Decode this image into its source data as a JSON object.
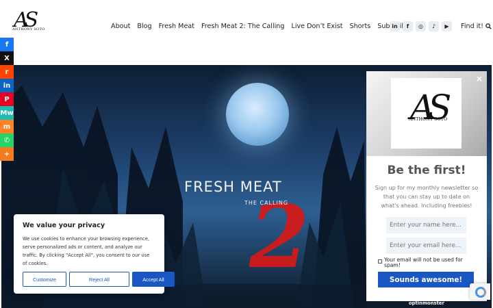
{
  "header": {
    "logo_mark": "AS",
    "logo_name": "ANTHONY SOTO",
    "nav": [
      "About",
      "Blog",
      "Fresh Meat",
      "Fresh Meat 2: The Calling",
      "Live Don’t Exist",
      "Shorts",
      "Subscribe"
    ],
    "social_icons": [
      "linkedin-icon",
      "facebook-icon",
      "instagram-icon",
      "tiktok-icon",
      "youtube-icon"
    ],
    "social_glyphs": [
      "in",
      "f",
      "◎",
      "♪",
      "▶"
    ],
    "find_label": "Find it!"
  },
  "share_bar": [
    {
      "name": "facebook",
      "glyph": "f",
      "color": "#1877f2"
    },
    {
      "name": "x",
      "glyph": "X",
      "color": "#111111"
    },
    {
      "name": "reddit",
      "glyph": "r",
      "color": "#ff4500"
    },
    {
      "name": "linkedin",
      "glyph": "in",
      "color": "#0a66c2"
    },
    {
      "name": "pinterest",
      "glyph": "P",
      "color": "#e60023"
    },
    {
      "name": "mewe",
      "glyph": "Mw",
      "color": "#1bbcb4"
    },
    {
      "name": "mix",
      "glyph": "m",
      "color": "#ff8226"
    },
    {
      "name": "whatsapp",
      "glyph": "✆",
      "color": "#25d366"
    },
    {
      "name": "more",
      "glyph": "+",
      "color": "#f47b20"
    }
  ],
  "hero": {
    "title": "FRESH MEAT",
    "subtitle": "THE CALLING",
    "numeral": "2"
  },
  "cookie": {
    "title": "We value your privacy",
    "body": "We use cookies to enhance your browsing experience, serve personalized ads or content, and analyze our traffic. By clicking \"Accept All\", you consent to our use of cookies.",
    "customize": "Customize",
    "reject": "Reject All",
    "accept": "Accept All"
  },
  "popup": {
    "close": "×",
    "logo_mark": "AS",
    "logo_name": "ANTHONY SOTO",
    "heading": "Be the first!",
    "body": "Sign up for my monthly newsletter so that you can stay up to date on what's ahead. Including freebies!",
    "name_placeholder": "Enter your name here...",
    "email_placeholder": "Enter your email here...",
    "consent": "Your email will not be used for spam!",
    "submit": "Sounds awesome!",
    "brand": "optinmonster"
  }
}
